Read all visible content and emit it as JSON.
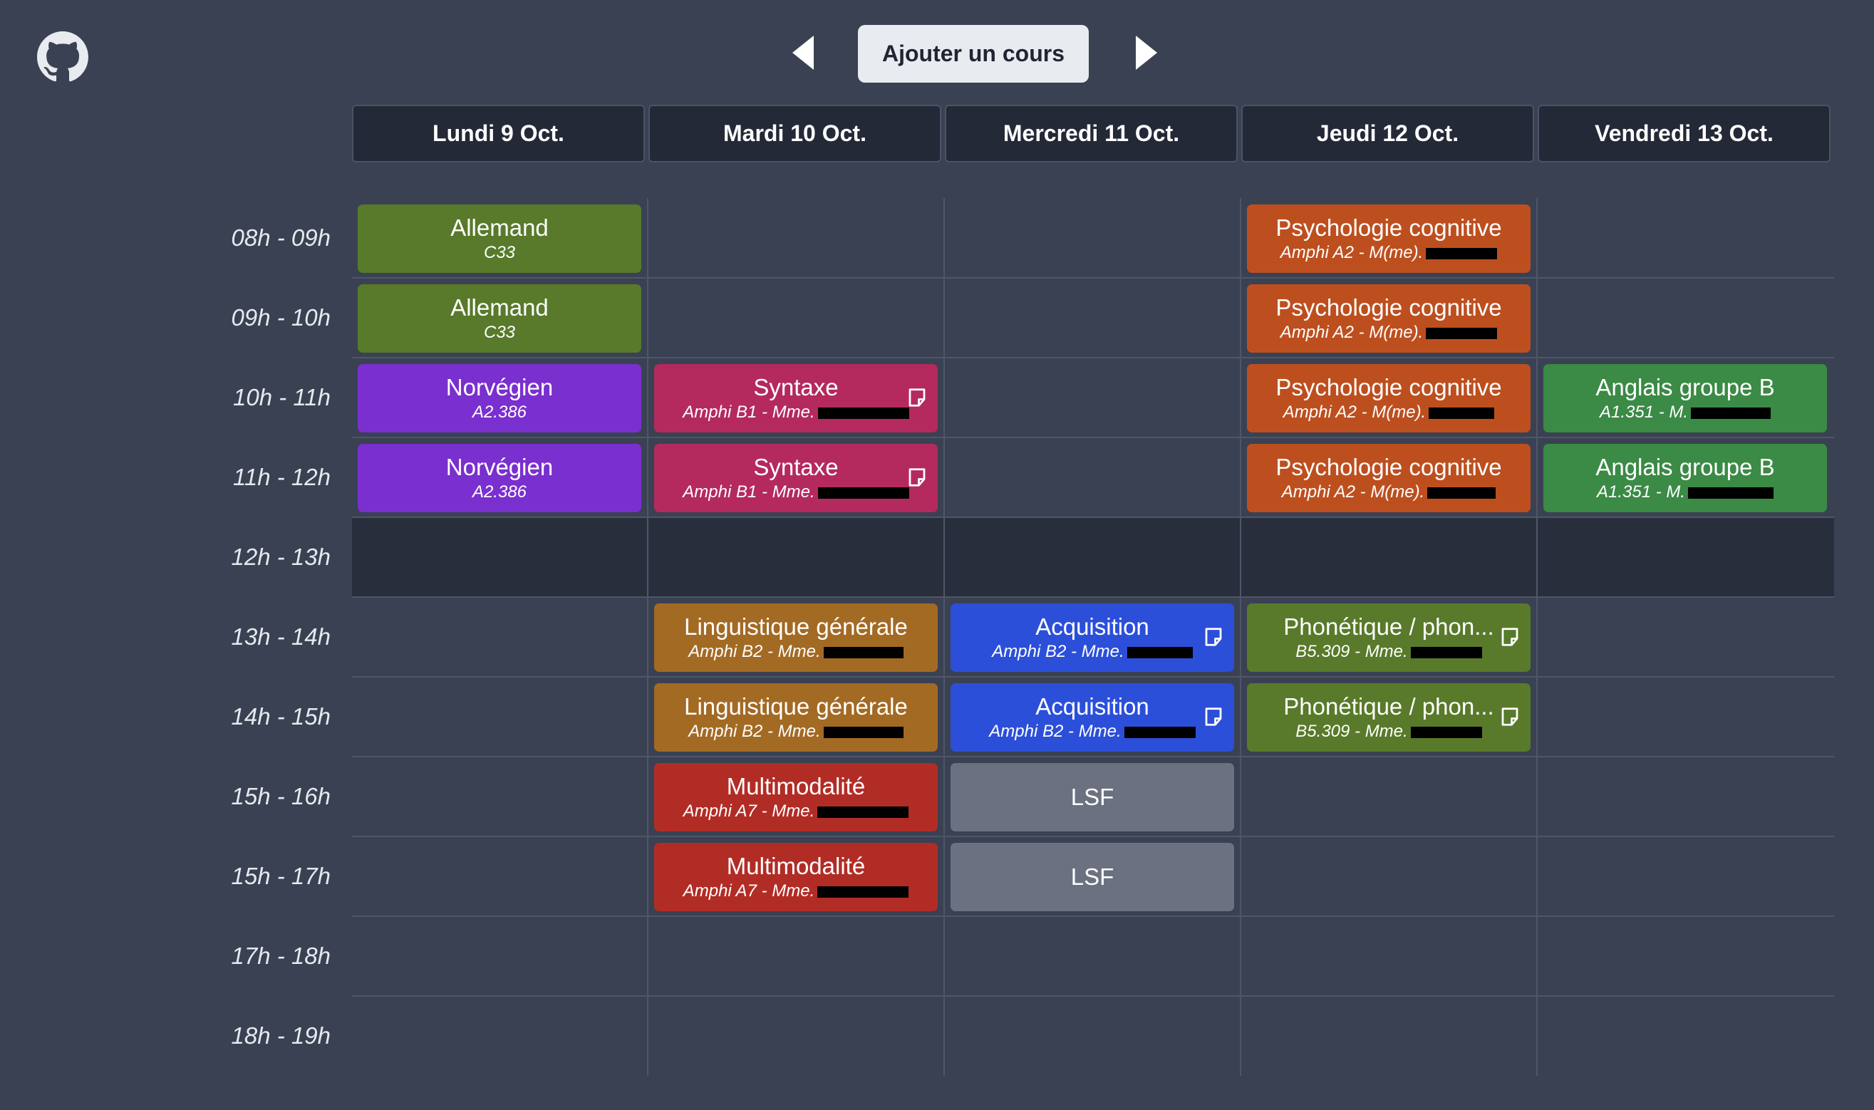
{
  "toolbar": {
    "github_icon": "github-icon",
    "prev_icon": "caret-left-icon",
    "next_icon": "caret-right-icon",
    "add_label": "Ajouter un cours"
  },
  "days": [
    "Lundi 9 Oct.",
    "Mardi 10 Oct.",
    "Mercredi 11 Oct.",
    "Jeudi 12 Oct.",
    "Vendredi 13 Oct."
  ],
  "time_slots": [
    "08h - 09h",
    "09h - 10h",
    "10h - 11h",
    "11h - 12h",
    "12h - 13h",
    "13h - 14h",
    "14h - 15h",
    "15h - 16h",
    "15h - 17h",
    "17h - 18h",
    "18h - 19h"
  ],
  "lunch_slot_index": 4,
  "colors": {
    "background": "#3a4152",
    "allemand": "#587a2a",
    "norvegien": "#7a2fcf",
    "syntaxe": "#b42a5e",
    "psychologie": "#bd4f1f",
    "anglais": "#3b8a46",
    "linguistique": "#a36a24",
    "acquisition": "#2c4fd9",
    "phonetique": "#587a2a",
    "multimodalite": "#b22c26",
    "lsf": "#6b7180"
  },
  "courses": [
    {
      "day": 0,
      "slot": 0,
      "name": "Allemand",
      "info": "C33",
      "color": "#587a2a",
      "note": false,
      "redacted": false
    },
    {
      "day": 0,
      "slot": 1,
      "name": "Allemand",
      "info": "C33",
      "color": "#587a2a",
      "note": false,
      "redacted": false
    },
    {
      "day": 0,
      "slot": 2,
      "name": "Norvégien",
      "info": "A2.386",
      "color": "#7a2fcf",
      "note": false,
      "redacted": false
    },
    {
      "day": 0,
      "slot": 3,
      "name": "Norvégien",
      "info": "A2.386",
      "color": "#7a2fcf",
      "note": false,
      "redacted": false
    },
    {
      "day": 1,
      "slot": 2,
      "name": "Syntaxe",
      "info": "Amphi B1 - Mme.",
      "color": "#b42a5e",
      "note": true,
      "redacted": true
    },
    {
      "day": 1,
      "slot": 3,
      "name": "Syntaxe",
      "info": "Amphi B1 - Mme.",
      "color": "#b42a5e",
      "note": true,
      "redacted": true
    },
    {
      "day": 3,
      "slot": 0,
      "name": "Psychologie cognitive",
      "info": "Amphi A2 - M(me).",
      "color": "#bd4f1f",
      "note": false,
      "redacted": true
    },
    {
      "day": 3,
      "slot": 1,
      "name": "Psychologie cognitive",
      "info": "Amphi A2 - M(me).",
      "color": "#bd4f1f",
      "note": false,
      "redacted": true
    },
    {
      "day": 3,
      "slot": 2,
      "name": "Psychologie cognitive",
      "info": "Amphi A2 - M(me).",
      "color": "#bd4f1f",
      "note": false,
      "redacted": true
    },
    {
      "day": 3,
      "slot": 3,
      "name": "Psychologie cognitive",
      "info": "Amphi A2 - M(me).",
      "color": "#bd4f1f",
      "note": false,
      "redacted": true
    },
    {
      "day": 4,
      "slot": 2,
      "name": "Anglais groupe B",
      "info": "A1.351 - M.",
      "color": "#3b8a46",
      "note": false,
      "redacted": true
    },
    {
      "day": 4,
      "slot": 3,
      "name": "Anglais groupe B",
      "info": "A1.351 - M.",
      "color": "#3b8a46",
      "note": false,
      "redacted": true
    },
    {
      "day": 1,
      "slot": 5,
      "name": "Linguistique générale",
      "info": "Amphi B2 - Mme.",
      "color": "#a36a24",
      "note": false,
      "redacted": true
    },
    {
      "day": 1,
      "slot": 6,
      "name": "Linguistique générale",
      "info": "Amphi B2 - Mme.",
      "color": "#a36a24",
      "note": false,
      "redacted": true
    },
    {
      "day": 2,
      "slot": 5,
      "name": "Acquisition",
      "info": "Amphi B2 - Mme.",
      "color": "#2c4fd9",
      "note": true,
      "redacted": true
    },
    {
      "day": 2,
      "slot": 6,
      "name": "Acquisition",
      "info": "Amphi B2 - Mme.",
      "color": "#2c4fd9",
      "note": true,
      "redacted": true
    },
    {
      "day": 3,
      "slot": 5,
      "name": "Phonétique / phon...",
      "info": "B5.309 - Mme.",
      "color": "#587a2a",
      "note": true,
      "redacted": true
    },
    {
      "day": 3,
      "slot": 6,
      "name": "Phonétique / phon...",
      "info": "B5.309 - Mme.",
      "color": "#587a2a",
      "note": true,
      "redacted": true
    },
    {
      "day": 1,
      "slot": 7,
      "name": "Multimodalité",
      "info": "Amphi A7 - Mme.",
      "color": "#b22c26",
      "note": false,
      "redacted": true
    },
    {
      "day": 1,
      "slot": 8,
      "name": "Multimodalité",
      "info": "Amphi A7 - Mme.",
      "color": "#b22c26",
      "note": false,
      "redacted": true
    },
    {
      "day": 2,
      "slot": 7,
      "name": "LSF",
      "info": "",
      "color": "#6b7180",
      "note": false,
      "redacted": false
    },
    {
      "day": 2,
      "slot": 8,
      "name": "LSF",
      "info": "",
      "color": "#6b7180",
      "note": false,
      "redacted": false
    }
  ]
}
